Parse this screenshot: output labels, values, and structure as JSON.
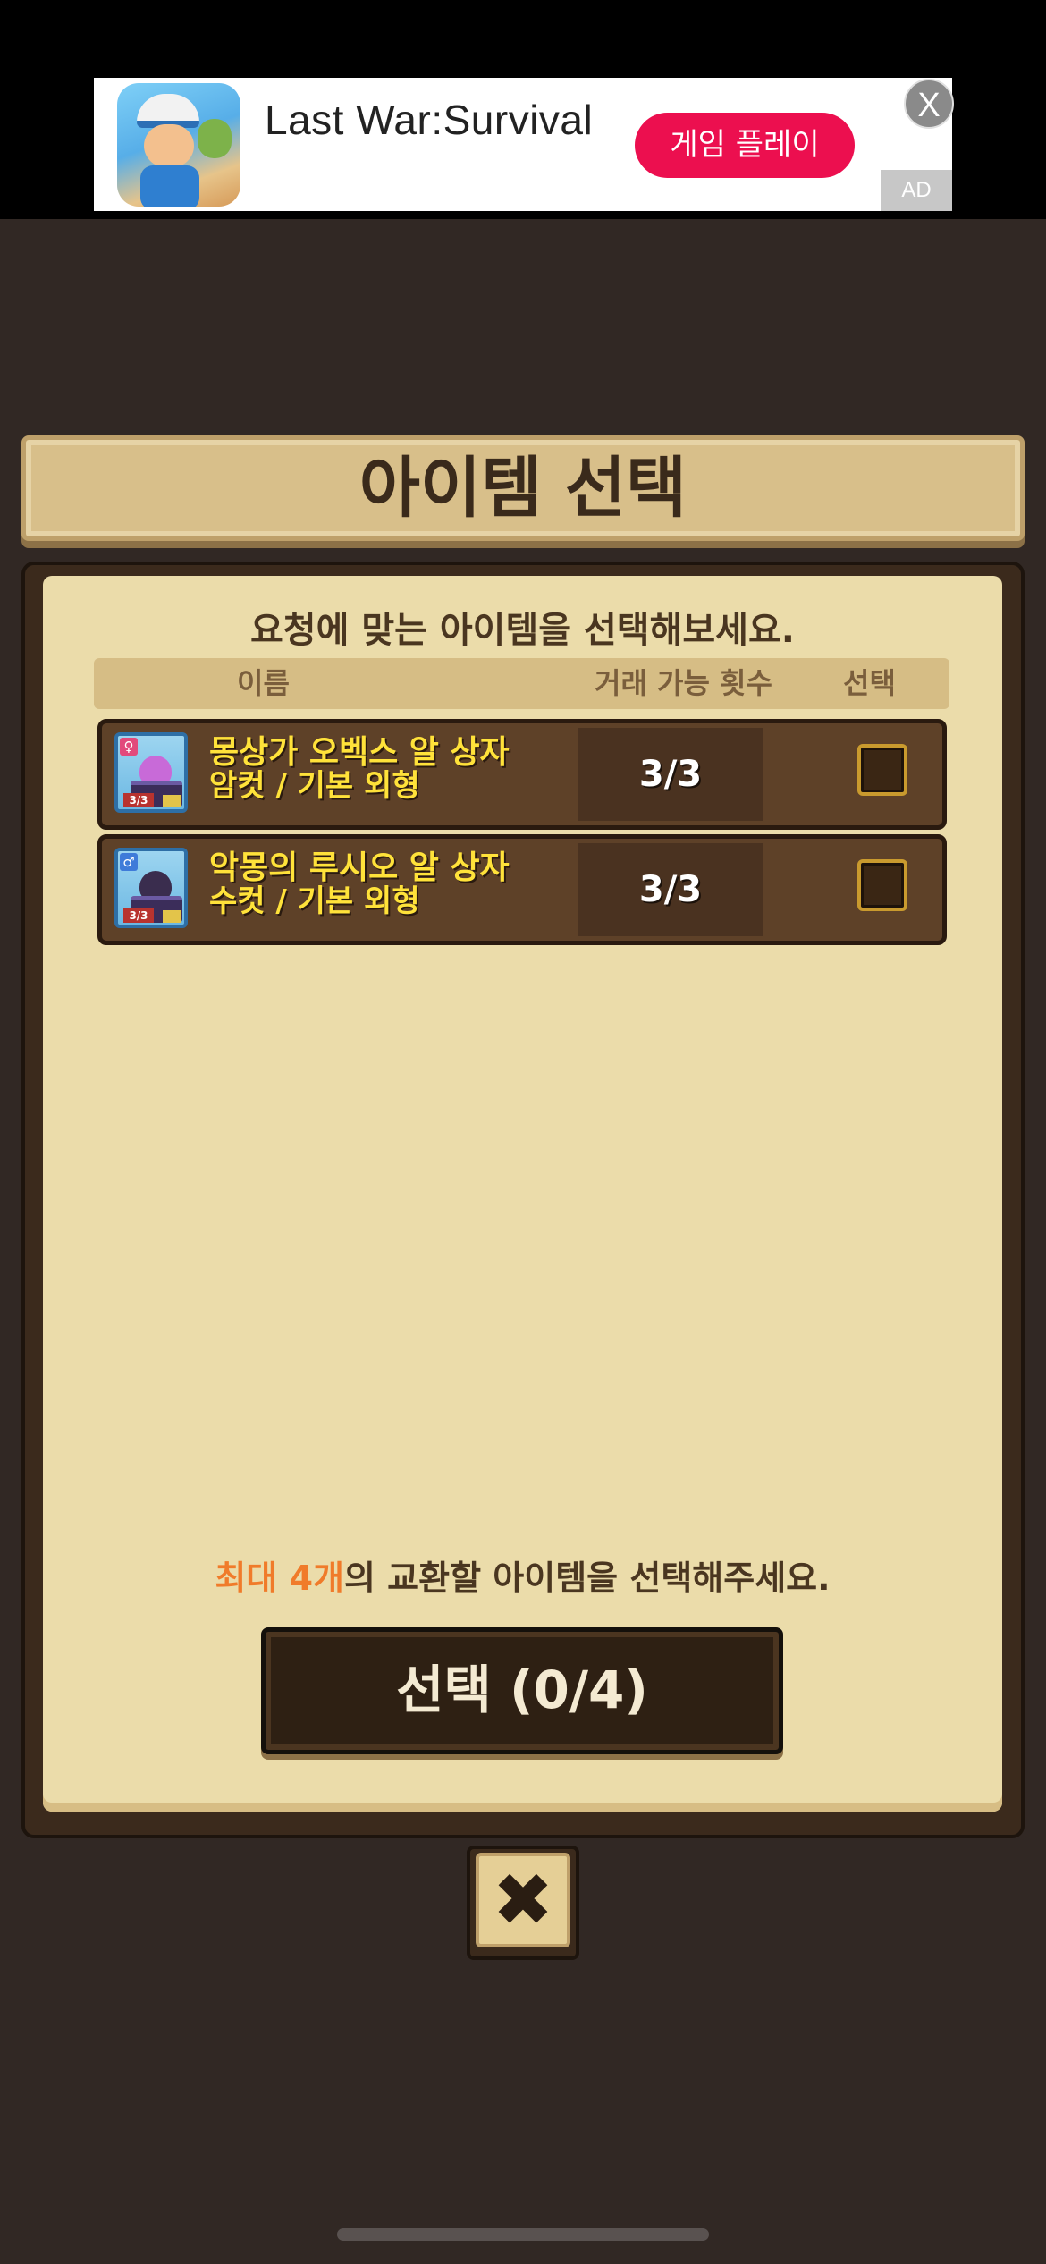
{
  "ad": {
    "app_name": "Last War:Survival",
    "cta_label": "게임 플레이",
    "close_label": "X",
    "badge_label": "AD"
  },
  "dialog": {
    "title": "아이템 선택",
    "subtitle": "요청에 맞는 아이템을 선택해보세요.",
    "columns": {
      "name": "이름",
      "trades": "거래 가능 횟수",
      "select": "선택"
    },
    "items": [
      {
        "name": "몽상가 오벡스 알 상자",
        "variant": "암컷 / 기본 외형",
        "trades": "3/3",
        "icon_count": "3/3",
        "gender": "female",
        "egg_color": "#c86ad8",
        "selected": false
      },
      {
        "name": "악몽의 루시오 알 상자",
        "variant": "수컷 / 기본 외형",
        "trades": "3/3",
        "icon_count": "3/3",
        "gender": "male",
        "egg_color": "#3a2d4e",
        "selected": false
      }
    ],
    "limit_highlight": "최대 4개",
    "limit_rest": "의 교환할 아이템을 선택해주세요.",
    "select_button_label": "선택 (0/4)",
    "close_glyph": "✖"
  },
  "colors": {
    "background": "#312824",
    "panel": "#ebdcaa",
    "highlight": "#f07b2a",
    "item_text": "#ffe23a",
    "ad_cta": "#ec0f4f"
  },
  "icons": [
    "ad-app-icon",
    "close-icon",
    "item-egg-box-icon",
    "female-icon",
    "male-icon",
    "checkbox-icon"
  ]
}
